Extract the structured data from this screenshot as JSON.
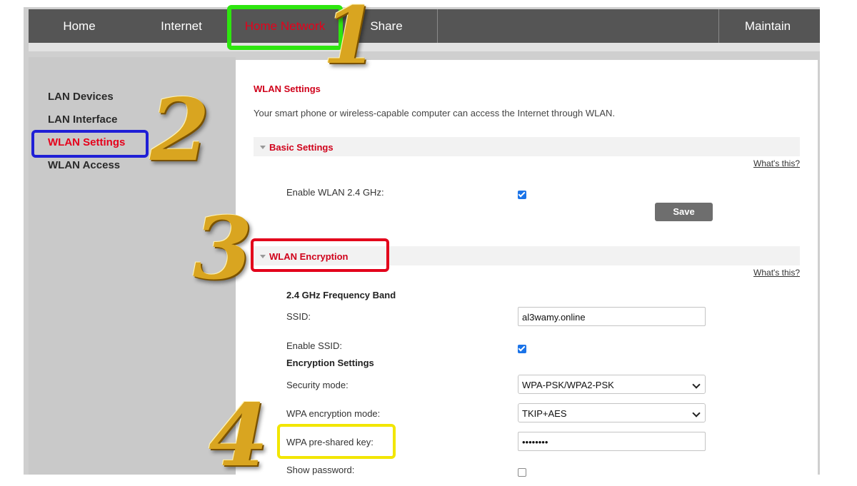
{
  "topnav": {
    "items": [
      {
        "label": "Home"
      },
      {
        "label": "Internet"
      },
      {
        "label": "Home Network",
        "active": true
      },
      {
        "label": "Share"
      },
      {
        "label": "Maintain"
      }
    ]
  },
  "sidebar": {
    "items": [
      {
        "label": "LAN Devices"
      },
      {
        "label": "LAN Interface"
      },
      {
        "label": "WLAN Settings",
        "active": true
      },
      {
        "label": "WLAN Access"
      }
    ]
  },
  "main": {
    "title": "WLAN Settings",
    "description": "Your smart phone or wireless-capable computer can access the Internet through WLAN.",
    "basic": {
      "header": "Basic Settings",
      "whats_this": "What's this?",
      "enable_label": "Enable WLAN 2.4 GHz:",
      "enable_checked": true,
      "save_label": "Save"
    },
    "encryption": {
      "header": "WLAN Encryption",
      "whats_this": "What's this?",
      "band_label": "2.4 GHz Frequency Band",
      "ssid_label": "SSID:",
      "ssid_value": "al3wamy.online",
      "enable_ssid_label": "Enable SSID:",
      "enable_ssid_checked": true,
      "settings_label": "Encryption Settings",
      "security_mode_label": "Security mode:",
      "security_mode_value": "WPA-PSK/WPA2-PSK",
      "wpa_mode_label": "WPA encryption mode:",
      "wpa_mode_value": "TKIP+AES",
      "psk_label": "WPA pre-shared key:",
      "psk_value": "••••••••",
      "show_password_label": "Show password:",
      "show_password_checked": false
    }
  },
  "annotations": {
    "step1": "1",
    "step2": "2",
    "step3": "3",
    "step4": "4",
    "colors": {
      "step1": "#2ee60f",
      "step2": "#1f1fd6",
      "step3": "#e3001b",
      "step4": "#f2e600"
    }
  }
}
